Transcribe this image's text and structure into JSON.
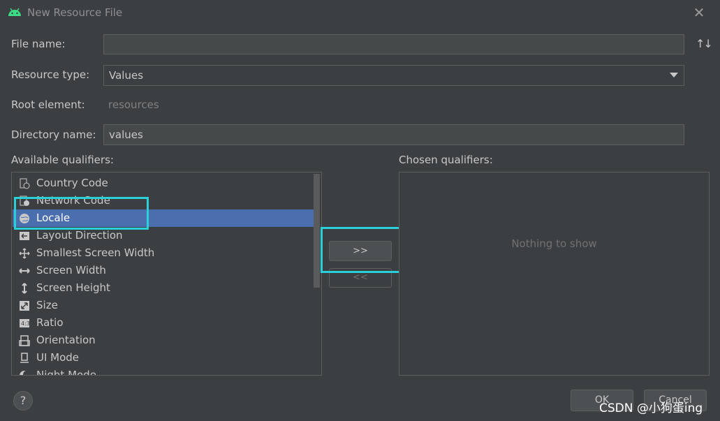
{
  "window": {
    "title": "New Resource File",
    "close": "✕"
  },
  "form": {
    "file_name_label": "File name:",
    "file_name_value": "",
    "sort_icon": "↑↓",
    "resource_type_label": "Resource type:",
    "resource_type_value": "Values",
    "root_element_label": "Root element:",
    "root_element_value": "resources",
    "directory_name_label": "Directory name:",
    "directory_name_value": "values"
  },
  "available": {
    "label": "Available qualifiers:",
    "items": [
      {
        "label": "Country Code",
        "icon": "country-code-icon"
      },
      {
        "label": "Network Code",
        "icon": "network-code-icon"
      },
      {
        "label": "Locale",
        "icon": "globe-icon"
      },
      {
        "label": "Layout Direction",
        "icon": "layout-direction-icon"
      },
      {
        "label": "Smallest Screen Width",
        "icon": "smallest-width-icon"
      },
      {
        "label": "Screen Width",
        "icon": "screen-width-icon"
      },
      {
        "label": "Screen Height",
        "icon": "screen-height-icon"
      },
      {
        "label": "Size",
        "icon": "size-icon"
      },
      {
        "label": "Ratio",
        "icon": "ratio-icon"
      },
      {
        "label": "Orientation",
        "icon": "orientation-icon"
      },
      {
        "label": "UI Mode",
        "icon": "ui-mode-icon"
      },
      {
        "label": "Night Mode",
        "icon": "night-mode-icon"
      }
    ],
    "selected_index": 2
  },
  "transfer": {
    "add": ">>",
    "remove": "<<"
  },
  "chosen": {
    "label": "Chosen qualifiers:",
    "empty": "Nothing to show"
  },
  "footer": {
    "help": "?",
    "ok": "OK",
    "cancel": "Cancel",
    "watermark": "CSDN @小狗蛋ing"
  },
  "colors": {
    "accent": "#4b6eaf",
    "highlight_box": "#2ad0d8",
    "background": "#3c3f41"
  }
}
